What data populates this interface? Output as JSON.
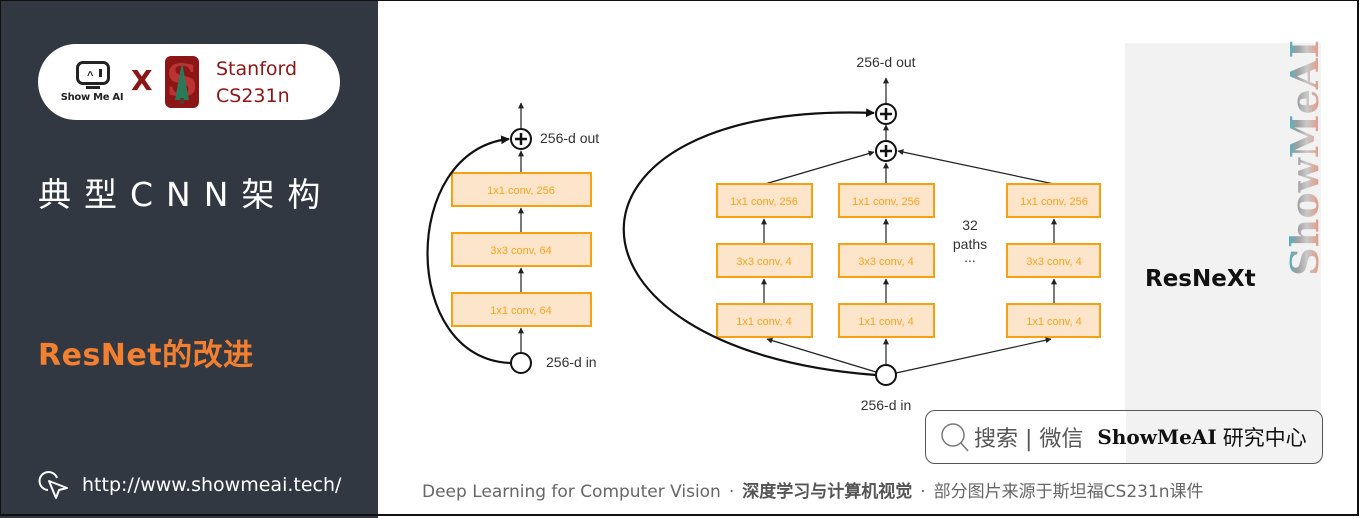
{
  "sidebar": {
    "logo_text": "Show Me AI",
    "times_symbol": "X",
    "partner_line1": "Stanford",
    "partner_line2": "CS231n",
    "course_title": "典型CNN架构",
    "section_title": "ResNet的改进",
    "site_url": "http://www.showmeai.tech/",
    "icons": [
      "showmeai-logo-icon",
      "stanford-logo-icon",
      "cursor-click-icon"
    ]
  },
  "diagram": {
    "resnet_block": {
      "input_label": "256-d in",
      "output_label": "256-d out",
      "layers": [
        "1x1 conv, 256",
        "3x3 conv, 64",
        "1x1 conv, 64"
      ]
    },
    "resnext_block": {
      "input_label": "256-d in",
      "output_label": "256-d out",
      "paths_count_label": "32",
      "paths_word_label": "paths",
      "ellipsis": "...",
      "path_layers": [
        "1x1 conv, 256",
        "3x3 conv, 4",
        "1x1 conv, 4"
      ],
      "visible_paths": 3
    },
    "colors": {
      "box_fill": "#fde5cc",
      "box_border": "#f7a010",
      "box_text": "#f7a31a"
    }
  },
  "panel": {
    "title": "ResNeXt",
    "watermark": "ShowMeAI"
  },
  "search": {
    "icon": "search-icon",
    "hint": "搜索 | 微信",
    "brand": "ShowMeAI",
    "brand_suffix": "研究中心"
  },
  "footer": {
    "part1": "Deep Learning for Computer Vision",
    "separator": "·",
    "part2": "深度学习与计算机视觉",
    "part3": "部分图片来源于斯坦福CS231n课件"
  },
  "colors": {
    "sidebar_bg": "#323842",
    "accent_orange": "#f28030",
    "stanford_red": "#8c1515",
    "panel_gray": "#f2f2f2"
  }
}
